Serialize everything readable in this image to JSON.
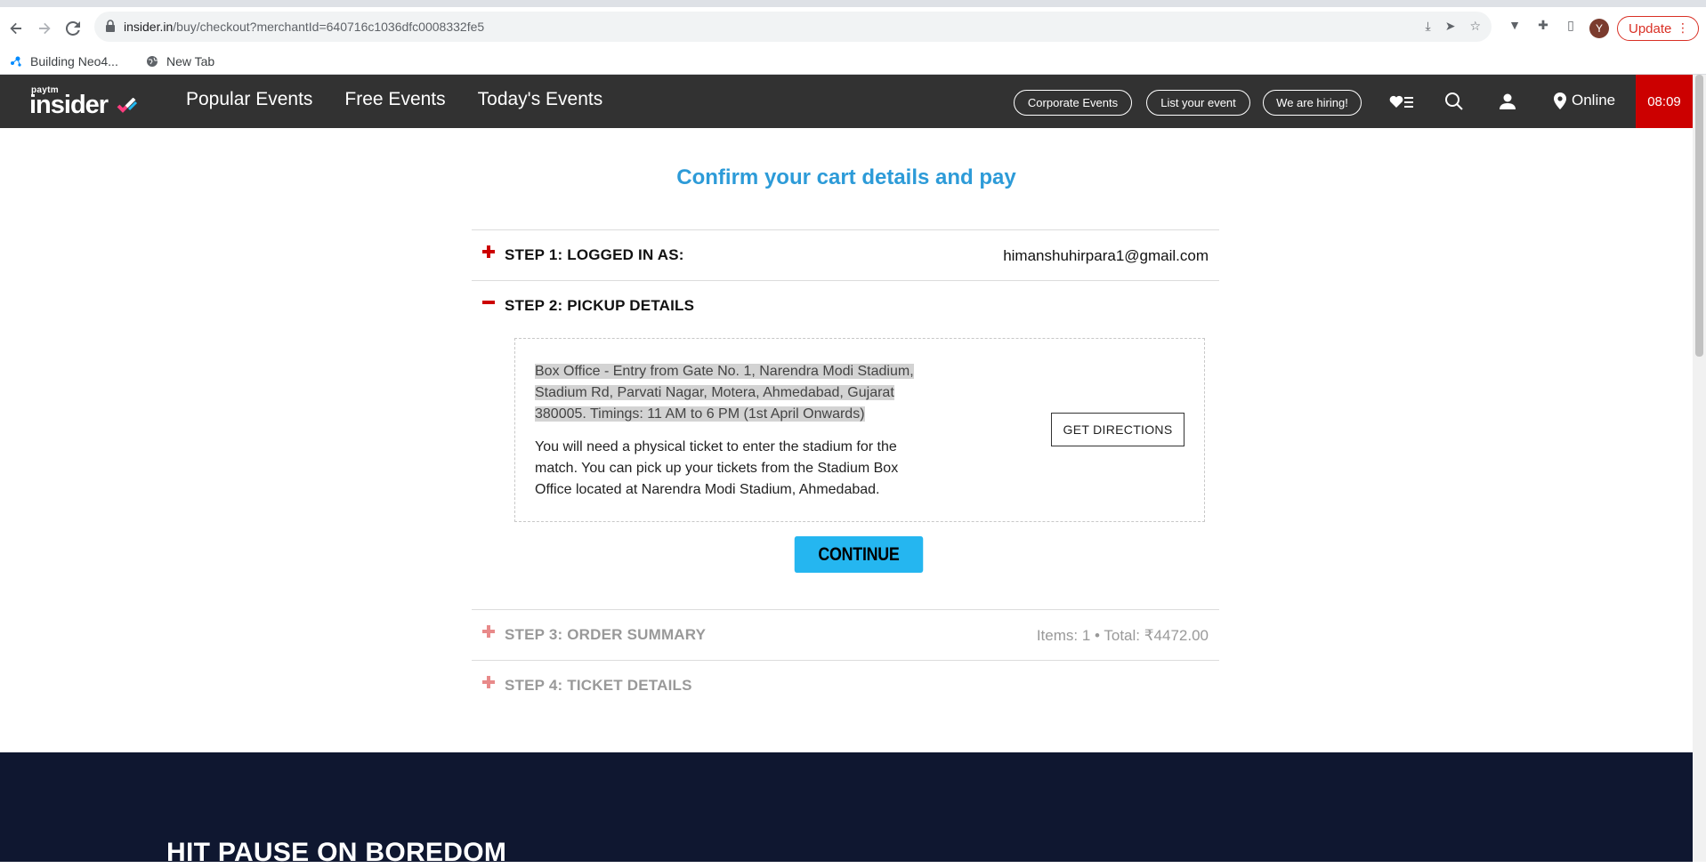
{
  "browser": {
    "url_host": "insider.in",
    "url_path": "/buy/checkout?merchantId=640716c1036dfc0008332fe5",
    "profile_initial": "Y",
    "update_label": "Update",
    "bookmarks": [
      {
        "label": "Building Neo4...",
        "icon": "neo4j-icon"
      },
      {
        "label": "New Tab",
        "icon": "globe-icon"
      }
    ]
  },
  "header": {
    "logo_top": "paytm",
    "logo_text": "insider",
    "nav": [
      "Popular Events",
      "Free Events",
      "Today's Events"
    ],
    "pills": [
      "Corporate Events",
      "List your event",
      "We are hiring!"
    ],
    "location": "Online",
    "timer": "08:09",
    "accent": "#cc0000"
  },
  "checkout": {
    "title": "Confirm your cart details and pay",
    "steps": [
      {
        "label": "STEP 1: LOGGED IN AS:",
        "right": "himanshuhirpara1@gmail.com",
        "state": "collapsed"
      },
      {
        "label": "STEP 2: PICKUP DETAILS",
        "right": "",
        "state": "expanded"
      },
      {
        "label": "STEP 3: ORDER SUMMARY",
        "right": "Items: 1 • Total: ₹4472.00",
        "state": "disabled"
      },
      {
        "label": "STEP 4: TICKET DETAILS",
        "right": "",
        "state": "disabled"
      }
    ],
    "pickup": {
      "address": "Box Office - Entry from Gate No. 1, Narendra Modi Stadium, Stadium Rd, Parvati Nagar, Motera, Ahmedabad, Gujarat 380005. Timings: 11 AM to 6 PM (1st April Onwards)",
      "note": "You will need a physical ticket to enter the stadium for the match. You can pick up your tickets from the Stadium Box Office located at Narendra Modi Stadium, Ahmedabad.",
      "directions_label": "GET DIRECTIONS"
    },
    "continue_label": "CONTINUE"
  },
  "footer": {
    "title": "HIT PAUSE ON BOREDOM"
  }
}
